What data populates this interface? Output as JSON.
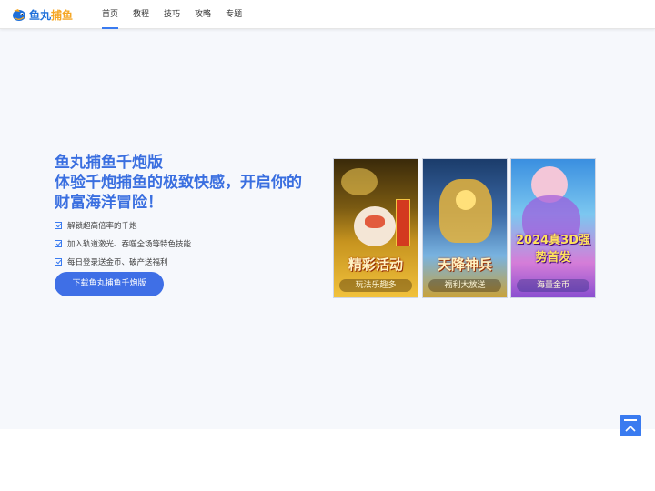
{
  "header": {
    "logo": {
      "part1": "鱼丸",
      "part2": "捕鱼"
    },
    "nav": [
      {
        "label": "首页",
        "active": true
      },
      {
        "label": "教程",
        "active": false
      },
      {
        "label": "技巧",
        "active": false
      },
      {
        "label": "攻略",
        "active": false
      },
      {
        "label": "专题",
        "active": false
      }
    ]
  },
  "hero": {
    "title_line1": "鱼丸捕鱼千炮版",
    "title_line2": "体验千炮捕鱼的极致快感，开启你的",
    "title_line3": "财富海洋冒险！",
    "features": [
      "解锁超高倍率的千炮",
      "加入轨道激光、吞噬全场等特色技能",
      "每日登录送金币、破产送福利"
    ],
    "download_button": "下载鱼丸捕鱼千炮版",
    "cards": [
      {
        "title": "精彩活动",
        "subtitle": "玩法乐趣多"
      },
      {
        "title": "天降神兵",
        "subtitle": "福利大放送"
      },
      {
        "title": "2024真3D强势首发",
        "subtitle": "海量金币"
      }
    ]
  },
  "colors": {
    "accent": "#3a7bf0",
    "title": "#3a6fe0",
    "hero_bg": "#f6f8fc"
  },
  "icons": {
    "back_to_top": "back-to-top-icon",
    "check": "checkbox-icon"
  }
}
